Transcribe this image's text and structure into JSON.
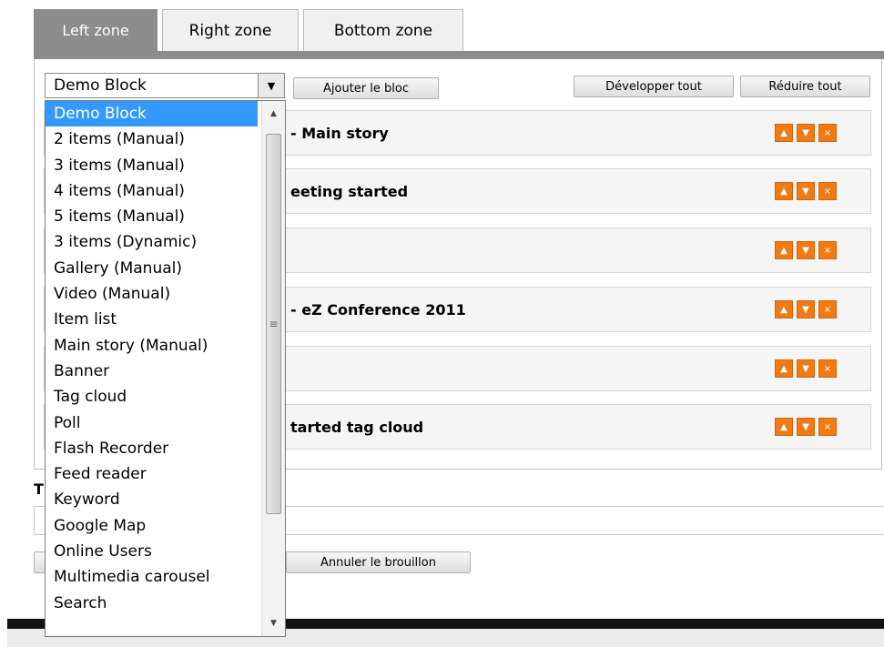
{
  "tabs": [
    {
      "label": "Left zone",
      "active": true
    },
    {
      "label": "Right zone",
      "active": false
    },
    {
      "label": "Bottom zone",
      "active": false
    }
  ],
  "block_select": {
    "value": "Demo Block",
    "options": [
      "Demo Block",
      "2 items (Manual)",
      "3 items (Manual)",
      "4 items (Manual)",
      "5 items (Manual)",
      "3 items (Dynamic)",
      "Gallery (Manual)",
      "Video (Manual)",
      "Item list",
      "Main story (Manual)",
      "Banner",
      "Tag cloud",
      "Poll",
      "Flash Recorder",
      "Feed reader",
      "Keyword",
      "Google Map",
      "Online Users",
      "Multimedia carousel",
      "Search"
    ]
  },
  "buttons": {
    "add_block": "Ajouter le bloc",
    "expand_all": "Développer tout",
    "collapse_all": "Réduire tout",
    "discard_draft": "Annuler le brouillon"
  },
  "blocks": [
    {
      "title": "- Main story"
    },
    {
      "title": "eeting started"
    },
    {
      "title": ""
    },
    {
      "title": "- eZ Conference 2011"
    },
    {
      "title": ""
    },
    {
      "title": "tarted tag cloud"
    }
  ],
  "block_controls": {
    "up": "^",
    "down": "v",
    "remove": "×"
  },
  "below_label": "T",
  "colors": {
    "active_tab": "#8c8c8c",
    "control_orange": "#f07a14",
    "selection_blue": "#3399ff"
  },
  "icons": {
    "select_arrow": "triangle-down",
    "scroll_up": "triangle-up",
    "scroll_down": "triangle-down",
    "scroll_grip": "three-lines"
  }
}
